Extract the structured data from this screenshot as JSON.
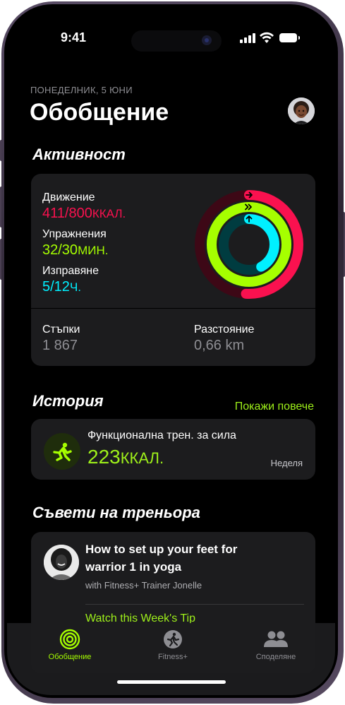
{
  "status": {
    "time": "9:41"
  },
  "header": {
    "date": "ПОНЕДЕЛНИК, 5 ЮНИ",
    "title": "Обобщение"
  },
  "activity": {
    "heading": "Активност",
    "move": {
      "label": "Движение",
      "value": "411/800",
      "unit": "ККАЛ.",
      "color": "#fa114f",
      "progress": 0.51
    },
    "exercise": {
      "label": "Упражнения",
      "value": "32/30",
      "unit": "МИН.",
      "color": "#a6ff00",
      "progress": 1.07
    },
    "stand": {
      "label": "Изправяне",
      "value": "5/12",
      "unit": "Ч.",
      "color": "#00f0ff",
      "progress": 0.42
    },
    "steps": {
      "label": "Стъпки",
      "value": "1 867"
    },
    "distance": {
      "label": "Разстояние",
      "value": "0,66 km"
    }
  },
  "history": {
    "heading": "История",
    "more": "Покажи повече",
    "workout": {
      "title": "Функционална трен. за сила",
      "value": "223",
      "unit": "ККАЛ.",
      "day": "Неделя"
    }
  },
  "tips": {
    "heading": "Съвети на треньора",
    "title": "How to set up your feet for warrior 1 in yoga",
    "subtitle": "with Fitness+ Trainer Jonelle",
    "link": "Watch this Week's Tip"
  },
  "tabbar": {
    "items": [
      {
        "label": "Обобщение",
        "active": true
      },
      {
        "label": "Fitness+",
        "active": false
      },
      {
        "label": "Споделяне",
        "active": false
      }
    ]
  }
}
